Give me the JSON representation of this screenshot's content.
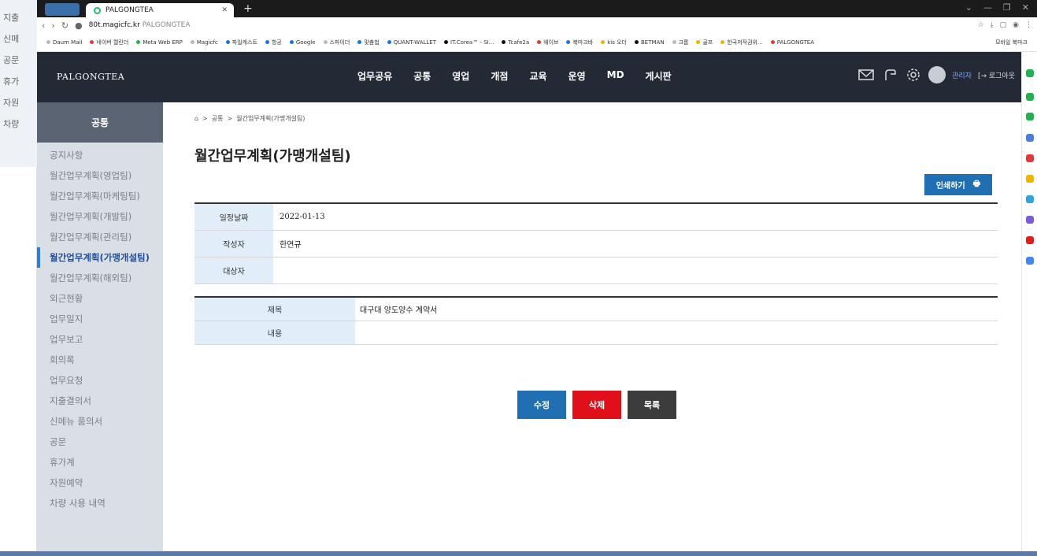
{
  "bg_left": {
    "items": [
      "지출",
      "신메",
      "공문",
      "휴가",
      "자원",
      "차량"
    ]
  },
  "browser": {
    "tab_title": "PALGONGTEA",
    "new_tab": "+",
    "url_host": "80t.magicfc.kr",
    "url_rest": "PALGONGTEA",
    "bookmarks": [
      "Daum Mail",
      "네이버 캘린더",
      "Meta Web ERP",
      "Magicfc",
      "파일캐스트",
      "항공",
      "Google",
      "스파이더",
      "맞춤법",
      "QUANT-WALLET",
      "IT.Corea™ - SI...",
      "Tcafe2a",
      "웨이브",
      "북마크바",
      "kis 오더",
      "BETMAN",
      "크롬",
      "골프",
      "한국저작권위...",
      "PALGONGTEA"
    ],
    "bookmark_right": "모바일 북마크"
  },
  "header": {
    "logo": "PALGONGTEA",
    "nav": [
      "업무공유",
      "공통",
      "영업",
      "개점",
      "교육",
      "운영",
      "MD",
      "게시판"
    ],
    "admin": "관리자",
    "logout": "[→ 로그아웃"
  },
  "sidebar": {
    "title": "공통",
    "items": [
      "공지사항",
      "월간업무계획(영업팀)",
      "월간업무계획(마케팅팀)",
      "월간업무계획(개발팀)",
      "월간업무계획(관리팀)",
      "월간업무계획(가맹개설팀)",
      "월간업무계획(해외팀)",
      "외근현황",
      "업무일지",
      "업무보고",
      "회의록",
      "업무요청",
      "지출결의서",
      "신메뉴 품의서",
      "공문",
      "휴가계",
      "자원예약",
      "차량 사용 내역"
    ],
    "active_index": 5
  },
  "breadcrumb": {
    "home": "⌂",
    "sep": ">",
    "level1": "공통",
    "level2": "월간업무계획(가맹개설팀)"
  },
  "page_title": "월간업무계획(가맹개설팀)",
  "print_label": "인쇄하기",
  "info": {
    "date_label": "일정날짜",
    "date_value": "2022-01-13",
    "author_label": "작성자",
    "author_value": "한연규",
    "target_label": "대상자",
    "target_value": ""
  },
  "detail": {
    "subject_label": "제목",
    "subject_value": "대구대 양도양수 계약서",
    "content_label": "내용",
    "content_value": ""
  },
  "buttons": {
    "edit": "수정",
    "delete": "삭제",
    "list": "목록"
  }
}
